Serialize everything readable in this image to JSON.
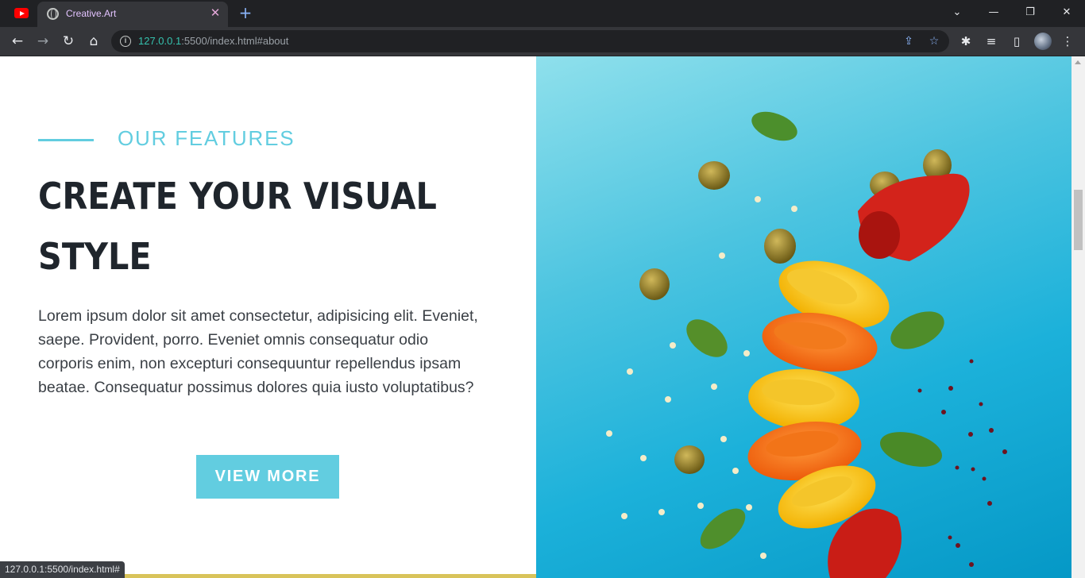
{
  "browser": {
    "tab": {
      "title": "Creative.Art",
      "close_label": "✕",
      "favicon": "globe-icon"
    },
    "new_tab_label": "+",
    "pinned_tab_icon": "youtube-icon",
    "window_controls": {
      "tab_search": "⌄",
      "minimize": "—",
      "restore": "❐",
      "close": "✕"
    },
    "nav": {
      "back": "←",
      "forward": "→",
      "reload": "↻",
      "home": "⌂"
    },
    "url": {
      "host": "127.0.0.1",
      "rest": ":5500/index.html#about"
    },
    "toolbar_icons": [
      "share-icon",
      "bookmark-star-icon",
      "extensions-icon",
      "media-queue-icon",
      "side-panel-icon",
      "profile-avatar-icon",
      "menu-icon"
    ],
    "status_text": "127.0.0.1:5500/index.html#"
  },
  "page": {
    "section_label": "OUR FEATURES",
    "headline": "CREATE YOUR VISUAL\nSTYLE",
    "body": "Lorem ipsum dolor sit amet consectetur, adipisicing elit. Eveniet, saepe. Provident, porro. Eveniet omnis consequatur odio corporis enim, non excepturi consequuntur repellendus ipsam beatae. Consequatur possimus dolores quia iusto voluptatibus?",
    "cta_label": "VIEW MORE",
    "image_subject": "flying sliced peppers, olives, basil and pepper seeds on blue background"
  },
  "colors": {
    "accent": "#62cde0",
    "heading": "#1f252c",
    "hero_blue": "#1cb1da",
    "underline_bar": "#d8c35a"
  }
}
